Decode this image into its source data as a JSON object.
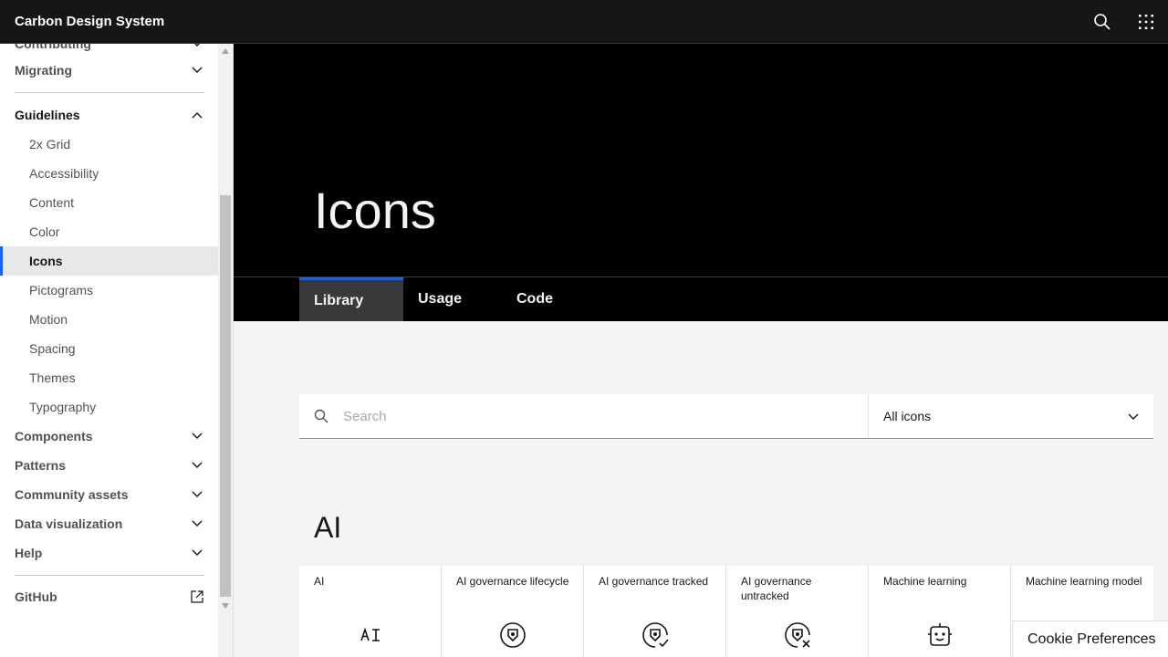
{
  "header": {
    "title": "Carbon Design System"
  },
  "sidebar": {
    "partial_item": "Contributing",
    "migrating": "Migrating",
    "guidelines": {
      "label": "Guidelines",
      "items": [
        "2x Grid",
        "Accessibility",
        "Content",
        "Color",
        "Icons",
        "Pictograms",
        "Motion",
        "Spacing",
        "Themes",
        "Typography"
      ],
      "active": "Icons"
    },
    "sections": [
      "Components",
      "Patterns",
      "Community assets",
      "Data visualization",
      "Help"
    ],
    "github": "GitHub"
  },
  "hero": {
    "title": "Icons"
  },
  "tabs": [
    "Library",
    "Usage",
    "Code"
  ],
  "search": {
    "placeholder": "Search",
    "filter_value": "All icons"
  },
  "category": {
    "title": "AI",
    "icons": [
      {
        "name": "AI",
        "glyph": "ai-icon"
      },
      {
        "name": "AI governance lifecycle",
        "glyph": "ai-governance-lifecycle-icon"
      },
      {
        "name": "AI governance tracked",
        "glyph": "ai-governance-tracked-icon"
      },
      {
        "name": "AI governance untracked",
        "glyph": "ai-governance-untracked-icon"
      },
      {
        "name": "Machine learning",
        "glyph": "machine-learning-icon"
      },
      {
        "name": "Machine learning model",
        "glyph": "machine-learning-model-icon"
      }
    ]
  },
  "cookie": {
    "label": "Cookie Preferences"
  },
  "colors": {
    "accent": "#0f62fe",
    "header_bg": "#161616",
    "hero_bg": "#000000"
  }
}
